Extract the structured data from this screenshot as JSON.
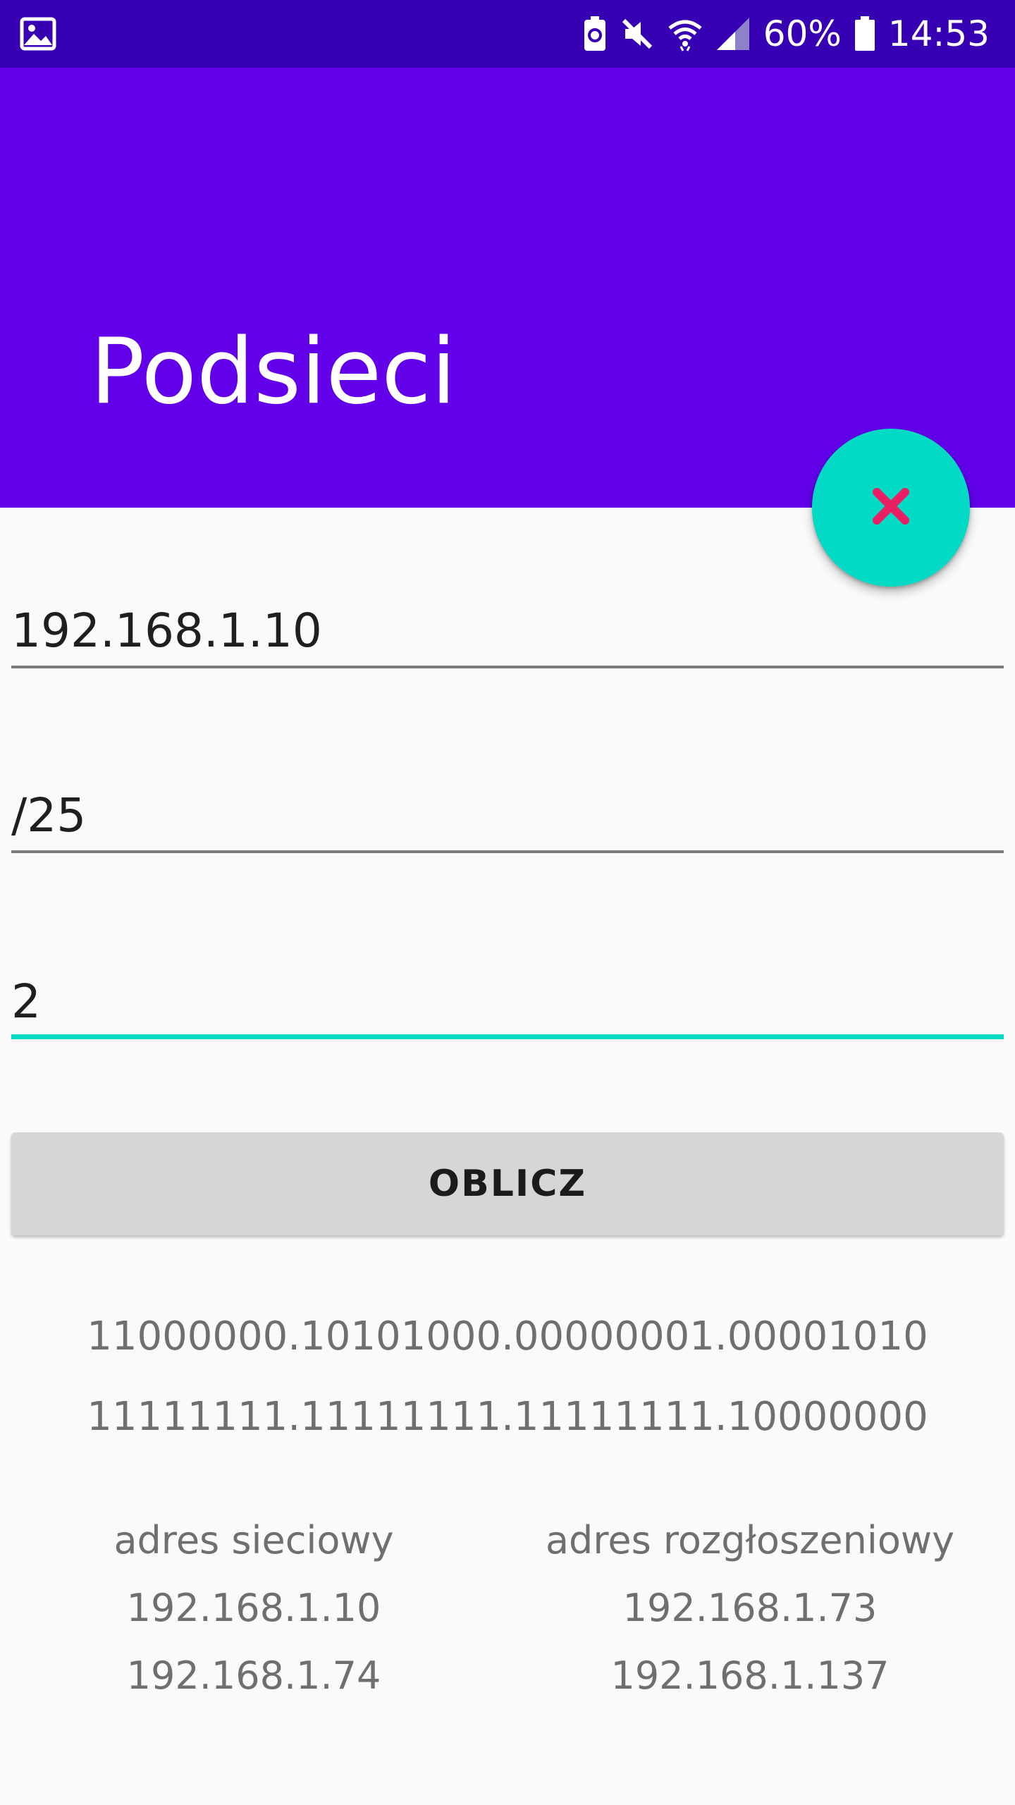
{
  "status_bar": {
    "battery_percent": "60%",
    "time": "14:53",
    "icons": [
      "image-icon",
      "battery-saver-icon",
      "mute-icon",
      "wifi-icon",
      "signal-icon",
      "battery-icon"
    ]
  },
  "app_bar": {
    "title": "Podsieci",
    "color": "#6200ea"
  },
  "fab": {
    "icon": "close-icon",
    "color": "#03dac5",
    "icon_color": "#e91e63"
  },
  "form": {
    "ip_address": "192.168.1.10",
    "mask": "/25",
    "subnets": "2",
    "calculate_label": "OBLICZ"
  },
  "binary": {
    "ip": "11000000.10101000.00000001.00001010",
    "mask": "11111111.11111111.11111111.10000000"
  },
  "results": {
    "network_header": "adres sieciowy",
    "broadcast_header": "adres rozgłoszeniowy",
    "rows": [
      {
        "network": "192.168.1.10",
        "broadcast": "192.168.1.73"
      },
      {
        "network": "192.168.1.74",
        "broadcast": "192.168.1.137"
      }
    ]
  }
}
